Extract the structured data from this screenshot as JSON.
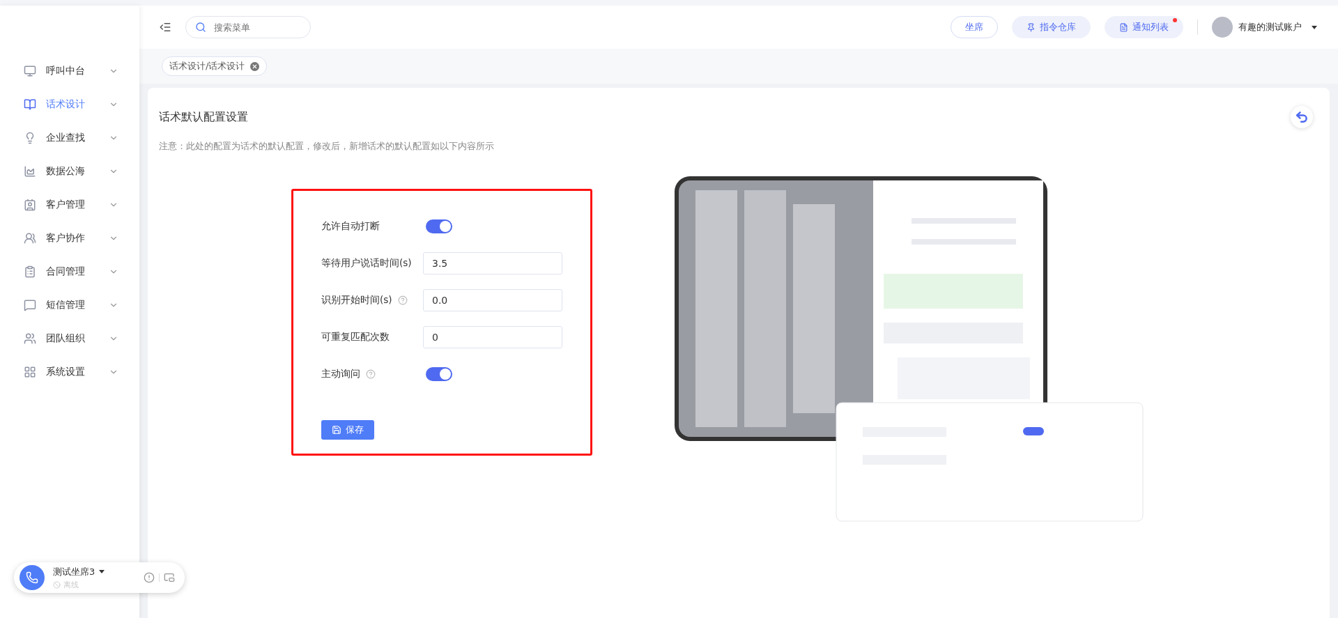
{
  "header": {
    "search": {
      "placeholder": "搜索菜单"
    },
    "buttons": [
      {
        "label": "坐席",
        "kind": "outline"
      },
      {
        "label": "指令仓库",
        "kind": "pin"
      },
      {
        "label": "通知列表",
        "kind": "notice",
        "badge": true
      }
    ],
    "user": {
      "name": "有趣的测试账户"
    }
  },
  "tags": [
    {
      "label": "话术设计/话术设计"
    }
  ],
  "sidebar": {
    "items": [
      {
        "label": "呼叫中台",
        "selected": false
      },
      {
        "label": "话术设计",
        "selected": true
      },
      {
        "label": "企业查找",
        "selected": false
      },
      {
        "label": "数据公海",
        "selected": false
      },
      {
        "label": "客户管理",
        "selected": false
      },
      {
        "label": "客户协作",
        "selected": false
      },
      {
        "label": "合同管理",
        "selected": false
      },
      {
        "label": "短信管理",
        "selected": false
      },
      {
        "label": "团队组织",
        "selected": false
      },
      {
        "label": "系统设置",
        "selected": false
      }
    ]
  },
  "page": {
    "title": "话术默认配置设置",
    "note": "注意：此处的配置为话术的默认配置，修改后，新增话术的默认配置如以下内容所示",
    "form": [
      {
        "kind": "switch",
        "label": "允许自动打断",
        "help": false,
        "on": true
      },
      {
        "kind": "input",
        "label": "等待用户说话时间(s)",
        "help": false,
        "value": "3.5"
      },
      {
        "kind": "input",
        "label": "识别开始时间(s)",
        "help": true,
        "value": "0.0"
      },
      {
        "kind": "input",
        "label": "可重复匹配次数",
        "help": false,
        "value": "0"
      },
      {
        "kind": "switch",
        "label": "主动询问",
        "help": true,
        "on": true
      }
    ],
    "save": "保存"
  },
  "agent": {
    "name": "测试坐席3",
    "status": "离线"
  }
}
